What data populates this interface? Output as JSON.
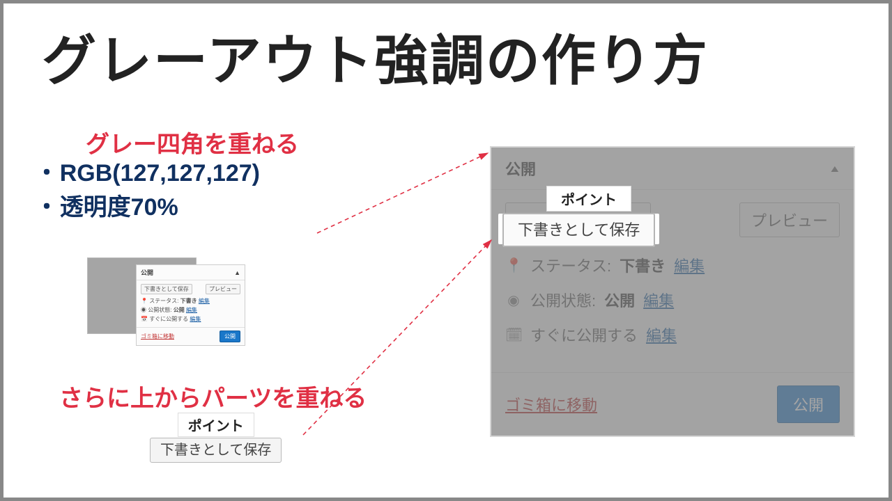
{
  "title": "グレーアウト強調の作り方",
  "sub1": "グレー四角を重ねる",
  "bullets": {
    "b1": "RGB(127,127,127)",
    "b2": "透明度70%"
  },
  "sub2": "さらに上からパーツを重ねる",
  "point_label": "ポイント",
  "save_draft_btn": "下書きとして保存",
  "preview_btn": "プレビュー",
  "panel": {
    "title": "公開",
    "status_label": "ステータス:",
    "status_value": "下書き",
    "visibility_label": "公開状態:",
    "visibility_value": "公開",
    "schedule_label": "すぐに公開する",
    "edit_link": "編集",
    "trash": "ゴミ箱に移動",
    "publish": "公開"
  },
  "icons": {
    "key": "🔑",
    "eye": "◉",
    "cal": "📅",
    "tri": "▲"
  }
}
